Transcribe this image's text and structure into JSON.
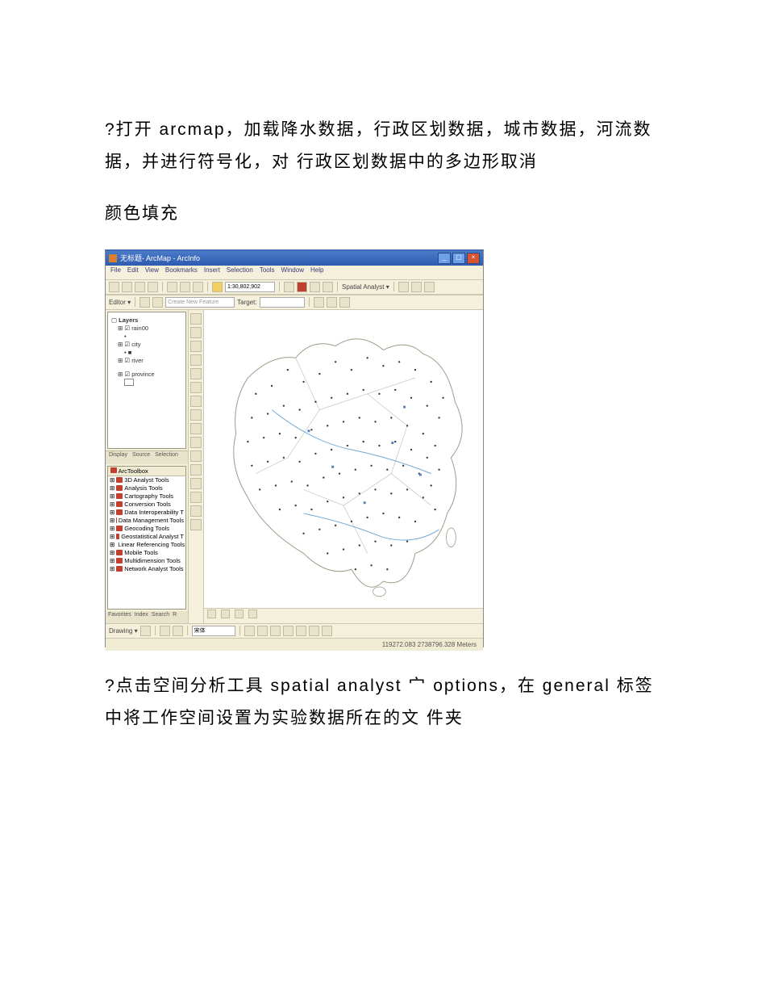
{
  "paragraphs": {
    "p1": "?打开 arcmap，加载降水数据，行政区划数据，城市数据，河流数据，并进行符号化，对 行政区划数据中的多边形取消",
    "p2": "颜色填充",
    "p3": "?点击空间分析工具 spatial analyst 宀 options，在 general 标签中将工作空间设置为实验数据所在的文 件夹"
  },
  "app": {
    "title_prefix": "无标题",
    "title_suffix": " - ArcMap - ArcInfo",
    "menus": [
      "File",
      "Edit",
      "View",
      "Bookmarks",
      "Insert",
      "Selection",
      "Tools",
      "Window",
      "Help"
    ],
    "scale_value": "1:30,802,902",
    "spatial_label": "Spatial Analyst ▾",
    "editor_label": "Editor ▾",
    "task_placeholder": "Create New Feature",
    "target_label": "Target:",
    "toc": {
      "root": "Layers",
      "items": [
        "rain00",
        "city",
        "river",
        "province"
      ]
    },
    "toc_tabs": [
      "Display",
      "Source",
      "Selection"
    ],
    "toolbox": {
      "header": "ArcToolbox",
      "items": [
        "3D Analyst Tools",
        "Analysis Tools",
        "Cartography Tools",
        "Conversion Tools",
        "Data Interoperability T",
        "Data Management Tools",
        "Geocoding Tools",
        "Geostatistical Analyst T",
        "Linear Referencing Tools",
        "Mobile Tools",
        "Multidimension Tools",
        "Network Analyst Tools"
      ],
      "tabs": [
        "Favorites",
        "Index",
        "Search",
        "R"
      ]
    },
    "drawing_label": "Drawing ▾",
    "font_name": "宋体",
    "status_coords": "119272.083 2738796.328 Meters"
  }
}
